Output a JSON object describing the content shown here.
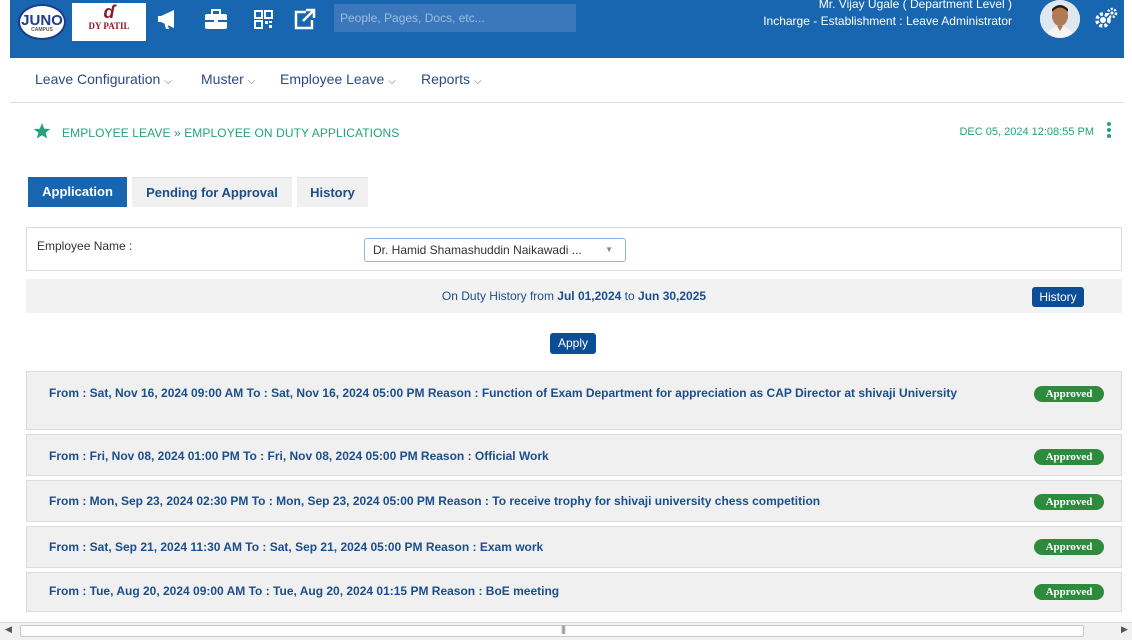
{
  "topbar": {
    "logo_juno": "JUNO",
    "logo_juno_sub": "CAMPUS",
    "logo_dyp": "DY PATIL",
    "search_placeholder": "People, Pages, Docs, etc...",
    "user_name": "Mr. Vijay Ugale ( Department Level )",
    "user_role": "Incharge - Establishment : Leave Administrator",
    "icons": [
      "megaphone-icon",
      "briefcase-icon",
      "qr-code-icon",
      "external-link-icon",
      "gear-icon"
    ],
    "bar_color": "#1866b0"
  },
  "menu": {
    "items": [
      {
        "label": "Leave Configuration"
      },
      {
        "label": "Muster"
      },
      {
        "label": "Employee Leave"
      },
      {
        "label": "Reports"
      }
    ]
  },
  "breadcrumb": {
    "text": "EMPLOYEE LEAVE » EMPLOYEE ON DUTY APPLICATIONS",
    "datetime": "DEC 05, 2024  12:08:55 PM",
    "accent_color": "#22a37a"
  },
  "tabs": [
    {
      "label": "Application",
      "active": true
    },
    {
      "label": "Pending for Approval",
      "active": false
    },
    {
      "label": "History",
      "active": false
    }
  ],
  "employee": {
    "label": "Employee Name :",
    "selected": "Dr. Hamid Shamashuddin Naikawadi ..."
  },
  "history_bar": {
    "prefix": "On Duty History from ",
    "from": "Jul 01,2024",
    "middle": " to ",
    "to": "Jun 30,2025",
    "button": "History"
  },
  "apply_button": "Apply",
  "applications": [
    {
      "text": "From : Sat, Nov 16, 2024 09:00 AM To : Sat, Nov 16, 2024 05:00 PM Reason : Function of Exam Department for appreciation as CAP Director at shivaji University",
      "status": "Approved"
    },
    {
      "text": "From : Fri, Nov 08, 2024 01:00 PM To : Fri, Nov 08, 2024 05:00 PM Reason : Official Work",
      "status": "Approved"
    },
    {
      "text": "From : Mon, Sep 23, 2024 02:30 PM To : Mon, Sep 23, 2024 05:00 PM Reason : To receive trophy for shivaji university chess competition",
      "status": "Approved"
    },
    {
      "text": "From : Sat, Sep 21, 2024 11:30 AM To : Sat, Sep 21, 2024 05:00 PM Reason : Exam work",
      "status": "Approved"
    },
    {
      "text": "From : Tue, Aug 20, 2024 09:00 AM To : Tue, Aug 20, 2024 01:15 PM Reason : BoE meeting",
      "status": "Approved"
    }
  ],
  "status_color": "#2e8b3e"
}
